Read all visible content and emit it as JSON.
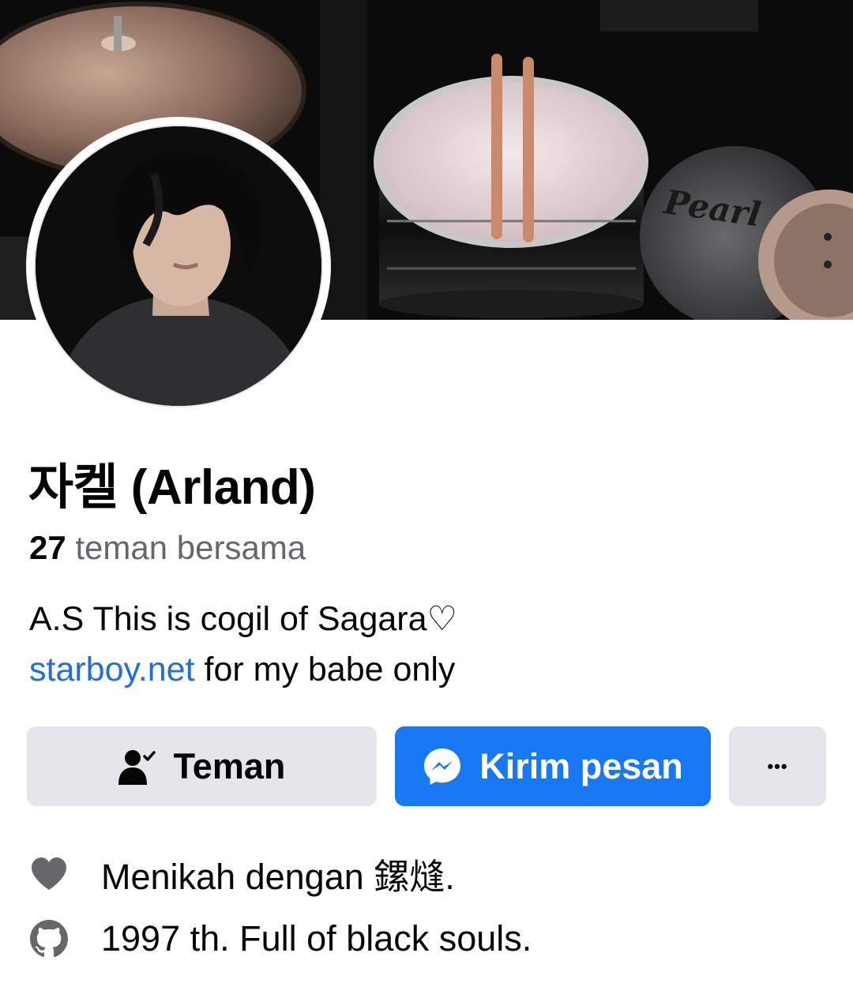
{
  "profile": {
    "name": "자켈 (Arland)",
    "mutual_count": "27",
    "mutual_label": "teman bersama",
    "bio_line1": "A.S This is cogil of Sagara♡",
    "bio_link": "starboy.net",
    "bio_line2_rest": " for my babe only",
    "cover_brand_text": "Pearl"
  },
  "actions": {
    "friends_label": "Teman",
    "message_label": "Kirim pesan",
    "more_label": "•••"
  },
  "details": {
    "relationship": "Menikah dengan 鏍熢.",
    "about": "1997 th. Full of black souls."
  },
  "colors": {
    "accent": "#1877f2",
    "link": "#216fdb",
    "button_grey": "#e4e6eb",
    "secondary_text": "#65676b"
  },
  "icons": {
    "friends": "person-check-icon",
    "message": "messenger-icon",
    "more": "more-dots-icon",
    "relationship": "heart-icon",
    "about": "github-icon"
  }
}
